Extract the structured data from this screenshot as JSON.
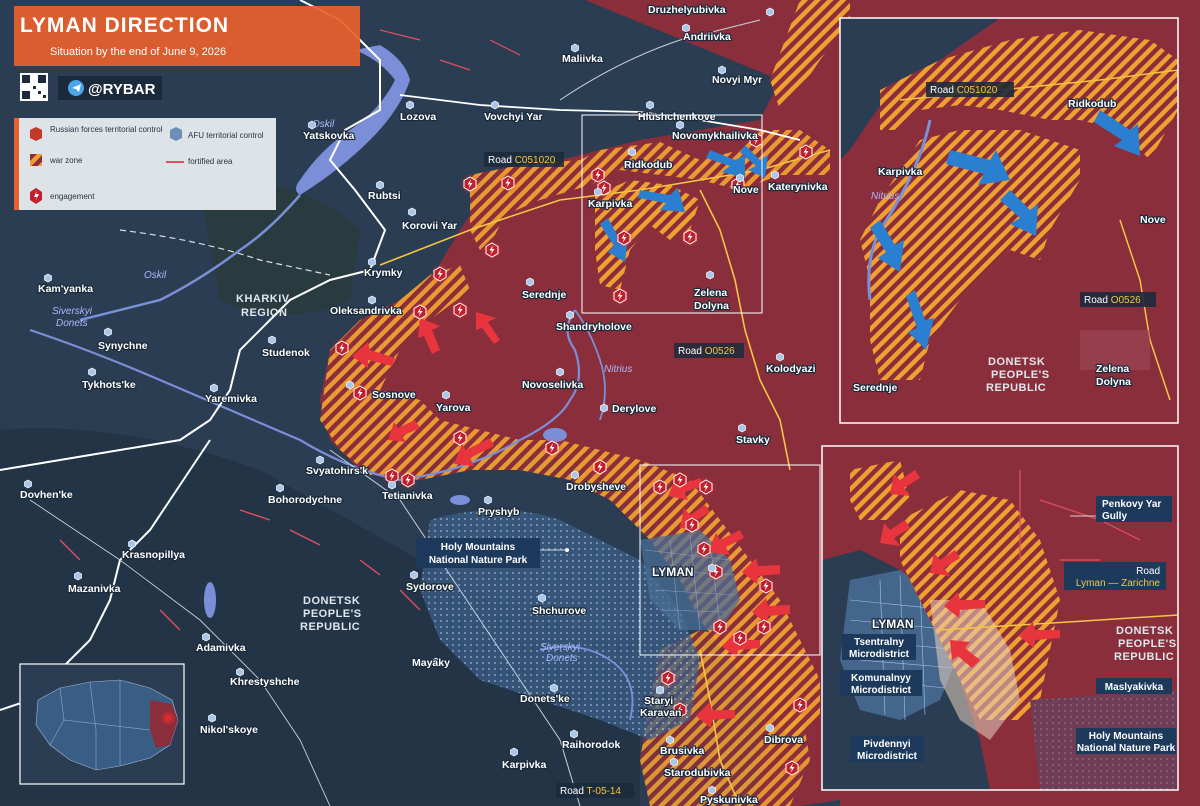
{
  "header": {
    "title": "LYMAN DIRECTION",
    "subtitle": "Situation by the end of June 9, 2026",
    "handle": "@RYBAR"
  },
  "legend": {
    "russian_control": "Russian forces territorial control",
    "afu_control": "AFU territorial control",
    "war_zone": "war zone",
    "fortified_area": "fortified area",
    "engagement": "engagement"
  },
  "colors": {
    "russian": "#8a2e3c",
    "afu": "#3a5d86",
    "warzone_orange": "#f0a030",
    "map_base": "#2b3d52",
    "arrow_red": "#e8343c",
    "arrow_blue": "#2b7fd0",
    "accent_orange": "#e8602c",
    "road_yellow": "#f5c542"
  },
  "regions": {
    "kharkiv_line1": "KHARKIV",
    "kharkiv_line2": "REGION",
    "donetsk_line1": "DONETSK",
    "donetsk_line2": "PEOPLE'S",
    "donetsk_line3": "REPUBLIC"
  },
  "water": {
    "oskil_upper": "Oskil",
    "oskil_lower": "Oskil",
    "siversky_donets_line1": "Siverskyi",
    "siversky_donets_line2": "Donets",
    "nitrius": "Nitrius",
    "siversky_donets2_line1": "Siverskyi",
    "siversky_donets2_line2": "Donets"
  },
  "roads": {
    "prefix": "Road",
    "c051020": "C051020",
    "o0526": "O0526",
    "t0514": "T-05-14"
  },
  "towns": {
    "druzhelyubivka": "Druzhelyubivka",
    "andriivka": "Andriivka",
    "maliivka": "Maliivka",
    "novyi_myr": "Novyi Myr",
    "lozova": "Lozova",
    "vovchyi_yar": "Vovchyi Yar",
    "hlushchenkove": "Hlushchenkove",
    "novomykhailivka": "Novomykhailivka",
    "yatskovka": "Yatskovka",
    "ridkodub": "Ridkodub",
    "katerynivka": "Katerynivka",
    "rubtsi": "Rubtsi",
    "karpivka": "Karpivka",
    "nove": "Nove",
    "korovii_yar": "Korovii Yar",
    "krymky": "Krymky",
    "kamyanka": "Kam'yanka",
    "serednje": "Serednje",
    "zelena_line1": "Zelena",
    "zelena_line2": "Dolyna",
    "oleksandrivka": "Oleksandrivka",
    "shandryholove": "Shandryholove",
    "synychne": "Synychne",
    "studenok": "Studenok",
    "kolodyazi": "Kolodyazi",
    "tykhotske": "Tykhots'ke",
    "novoselivka": "Novoselivka",
    "sosnove": "Sosnove",
    "yaremivka": "Yaremivka",
    "yarova": "Yarova",
    "derylove": "Derylove",
    "stavky": "Stavky",
    "svyatohirsk": "Svyatohirs'k",
    "dovhenke": "Dovhen'ke",
    "bohorodychne": "Bohorodychne",
    "tetianivka": "Tetianivka",
    "drobysheve": "Drobysheve",
    "pryshyb": "Pryshyb",
    "krasnopillya": "Krasnopillya",
    "holy_line1": "Holy Mountains",
    "holy_line2": "National Nature Park",
    "mazanivka": "Mazanivka",
    "sydorove": "Sydorove",
    "lyman": "LYMAN",
    "shchurove": "Shchurove",
    "adamivka": "Adamivka",
    "khrestyshche": "Khrestyshche",
    "mayaky": "Mayaky",
    "donetske": "Donets'ke",
    "staryi_line1": "Staryi",
    "staryi_line2": "Karavan",
    "nikolskoye": "Nikol'skoye",
    "raihorodok": "Raihorodok",
    "brusivka": "Brusivka",
    "dibrova": "Dibrova",
    "karpivka_s": "Karpivka",
    "starodubivka": "Starodubivka",
    "pyskunivka": "Pyskunivka"
  },
  "inset_north": {
    "ridkodub": "Ridkodub",
    "karpivka": "Karpivka",
    "nitrius": "Nitrius",
    "nove": "Nove",
    "serednje": "Serednje",
    "zelena_line1": "Zelena",
    "zelena_line2": "Dolyna",
    "dpr_line1": "DONETSK",
    "dpr_line2": "PEOPLE'S",
    "dpr_line3": "REPUBLIC"
  },
  "inset_south": {
    "penkovy_line1": "Penkovy Yar",
    "penkovy_line2": "Gully",
    "road_prefix": "Road",
    "road_name": "Lyman — Zarichne",
    "lyman": "LYMAN",
    "tsentralny_line1": "Tsentralny",
    "tsentralny_line2": "Microdistrict",
    "komunalnyy_line1": "Komunalnyy",
    "komunalnyy_line2": "Microdistrict",
    "pivdennyi_line1": "Pivdennyi",
    "pivdennyi_line2": "Microdistrict",
    "maslyakivka": "Maslyakivka",
    "holy_line1": "Holy Mountains",
    "holy_line2": "National Nature Park",
    "dpr_line1": "DONETSK",
    "dpr_line2": "PEOPLE'S",
    "dpr_line3": "REPUBLIC"
  }
}
